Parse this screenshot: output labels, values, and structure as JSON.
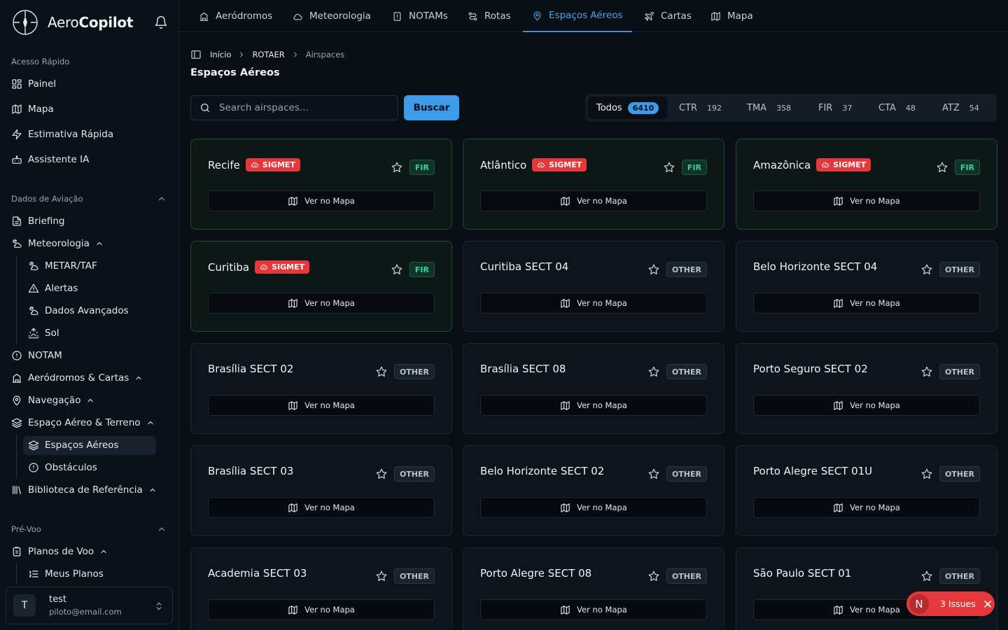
{
  "app": {
    "name_light": "Aero",
    "name_bold": "Copilot"
  },
  "sidebar": {
    "quick_access": "Acesso Rápido",
    "quick_items": [
      "Painel",
      "Mapa",
      "Estimativa Rápida",
      "Assistente IA"
    ],
    "aviation_data": "Dados de Aviação",
    "briefing": "Briefing",
    "meteorologia": "Meteorologia",
    "meteo_items": [
      "METAR/TAF",
      "Alertas",
      "Dados Avançados",
      "Sol"
    ],
    "notam": "NOTAM",
    "aerodromos_cartas": "Aeródromos & Cartas",
    "navegacao": "Navegação",
    "espaco_aereo_terreno": "Espaço Aéreo & Terreno",
    "espaco_items": [
      "Espaços Aéreos",
      "Obstáculos"
    ],
    "biblioteca": "Biblioteca de Referência",
    "pre_voo": "Pré-Voo",
    "planos_voo": "Planos de Voo",
    "meus_planos": "Meus Planos",
    "user": {
      "avatar": "T",
      "name": "test",
      "email": "piloto@email.com"
    }
  },
  "topnav": {
    "tabs": [
      "Aeródromos",
      "Meteorologia",
      "NOTAMs",
      "Rotas",
      "Espaços Aéreos",
      "Cartas",
      "Mapa"
    ],
    "active": "Espaços Aéreos"
  },
  "breadcrumb": [
    "Início",
    "ROTAER",
    "Airspaces"
  ],
  "page_title": "Espaços Aéreos",
  "search": {
    "placeholder": "Search airspaces...",
    "value": "",
    "button": "Buscar"
  },
  "filters": [
    {
      "label": "Todos",
      "count": "6410"
    },
    {
      "label": "CTR",
      "count": "192"
    },
    {
      "label": "TMA",
      "count": "358"
    },
    {
      "label": "FIR",
      "count": "37"
    },
    {
      "label": "CTA",
      "count": "48"
    },
    {
      "label": "ATZ",
      "count": "54"
    }
  ],
  "map_button": "Ver no Mapa",
  "sigmet_label": "SIGMET",
  "cards": [
    {
      "name": "Recife",
      "type": "FIR",
      "sigmet": true
    },
    {
      "name": "Atlântico",
      "type": "FIR",
      "sigmet": true
    },
    {
      "name": "Amazônica",
      "type": "FIR",
      "sigmet": true
    },
    {
      "name": "Curitiba",
      "type": "FIR",
      "sigmet": true
    },
    {
      "name": "Curitiba SECT 04",
      "type": "OTHER",
      "sigmet": false
    },
    {
      "name": "Belo Horizonte SECT 04",
      "type": "OTHER",
      "sigmet": false
    },
    {
      "name": "Brasília SECT 02",
      "type": "OTHER",
      "sigmet": false
    },
    {
      "name": "Brasília SECT 08",
      "type": "OTHER",
      "sigmet": false
    },
    {
      "name": "Porto Seguro SECT 02",
      "type": "OTHER",
      "sigmet": false
    },
    {
      "name": "Brasília SECT 03",
      "type": "OTHER",
      "sigmet": false
    },
    {
      "name": "Belo Horizonte SECT 02",
      "type": "OTHER",
      "sigmet": false
    },
    {
      "name": "Porto Alegre SECT 01U",
      "type": "OTHER",
      "sigmet": false
    },
    {
      "name": "Academia SECT 03",
      "type": "OTHER",
      "sigmet": false
    },
    {
      "name": "Porto Alegre SECT 08",
      "type": "OTHER",
      "sigmet": false
    },
    {
      "name": "São Paulo SECT 01",
      "type": "OTHER",
      "sigmet": false
    }
  ],
  "issues": {
    "avatar": "N",
    "label": "3 Issues"
  },
  "colors": {
    "accent": "#3d9be9",
    "fir": "#34d399",
    "sigmet": "#e5383b",
    "background": "#0a0f16"
  }
}
